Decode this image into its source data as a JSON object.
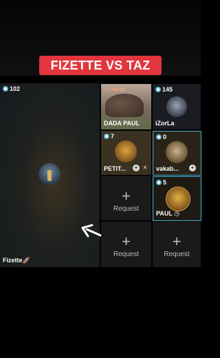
{
  "banner": {
    "title": "FIZETTE VS TAZ"
  },
  "main_tile": {
    "viewer_count": "102",
    "name": "Fizette🚀"
  },
  "tiles": [
    {
      "host_label": "Host",
      "name": "DADA PAUL"
    },
    {
      "viewer_count": "145",
      "name": "iZorLa"
    },
    {
      "viewer_count": "7",
      "name": "PETIT..."
    },
    {
      "viewer_count": "0",
      "name": "vakab..."
    },
    {
      "request_label": "Request"
    },
    {
      "viewer_count": "5",
      "name": "PAUL"
    },
    {
      "request_label": "Request"
    },
    {
      "request_label": "Request"
    }
  ],
  "icons": {
    "add": "plus-icon",
    "mute": "mic-off-icon",
    "arrow": "arrow-icon"
  },
  "colors": {
    "banner": "#e1363d",
    "highlight_border": "#4fb6d6",
    "viewer_icon": "#5ab4d9"
  }
}
